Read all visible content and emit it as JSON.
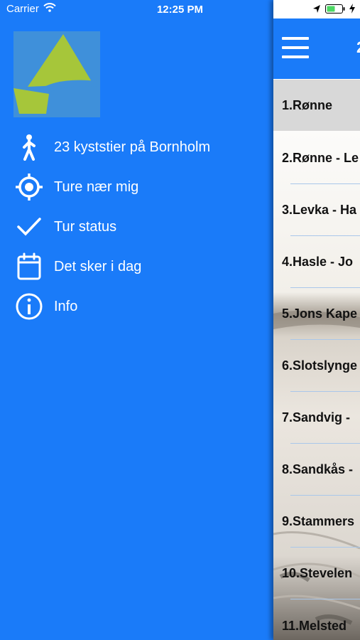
{
  "status_bar": {
    "carrier": "Carrier",
    "time": "12:25 PM"
  },
  "drawer": {
    "menu_items": [
      {
        "label": "23 kyststier på Bornholm",
        "icon": "walking-person-icon"
      },
      {
        "label": "Ture nær mig",
        "icon": "location-target-icon"
      },
      {
        "label": "Tur status",
        "icon": "checkmark-icon"
      },
      {
        "label": "Det sker i dag",
        "icon": "calendar-icon"
      },
      {
        "label": "Info",
        "icon": "info-icon"
      }
    ]
  },
  "main": {
    "header_title": "2",
    "routes": [
      {
        "label": "1.Rønne"
      },
      {
        "label": "2.Rønne - Le"
      },
      {
        "label": "3.Levka - Ha"
      },
      {
        "label": "4.Hasle - Jo"
      },
      {
        "label": "5.Jons Kape"
      },
      {
        "label": "6.Slotslynge"
      },
      {
        "label": "7.Sandvig -"
      },
      {
        "label": "8.Sandkås -"
      },
      {
        "label": "9.Stammers"
      },
      {
        "label": "10.Stevelen"
      },
      {
        "label": "11.Melsted"
      }
    ]
  },
  "colors": {
    "drawer_bg": "#1a7bf9",
    "logo_bg": "#3f90da",
    "logo_green": "#a6c63a",
    "selected_row": "#d8d8d8"
  }
}
